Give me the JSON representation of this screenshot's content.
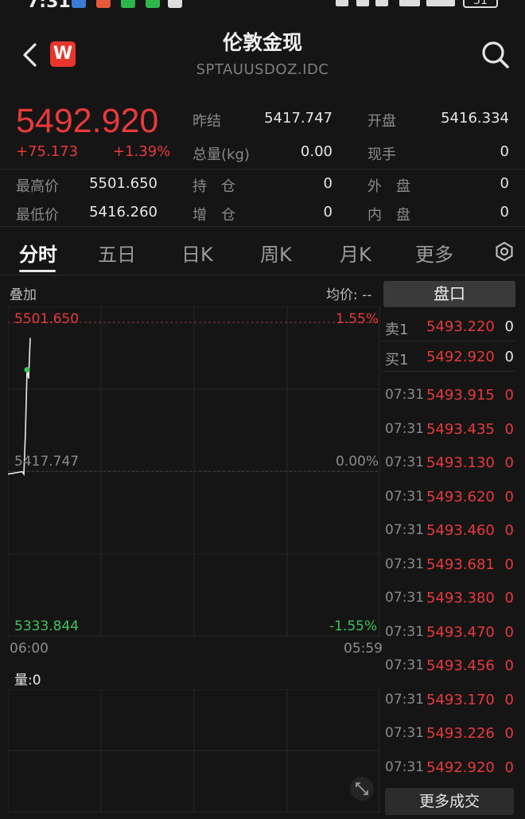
{
  "status_bar": {
    "time": "7:31",
    "battery": "51"
  },
  "header": {
    "title": "伦敦金现",
    "subtitle": "SPTAUUSDOZ.IDC",
    "logo_letter": "W"
  },
  "quote": {
    "price": "5492.920",
    "change": "+75.173",
    "change_pct": "+1.39%",
    "stats": [
      {
        "label": "昨结",
        "value": "5417.747"
      },
      {
        "label": "开盘",
        "value": "5416.334"
      },
      {
        "label": "总量(kg)",
        "value": "0.00"
      },
      {
        "label": "现手",
        "value": "0"
      },
      {
        "label": "最高价",
        "value": "5501.650"
      },
      {
        "label": "持　仓",
        "value": "0"
      },
      {
        "label": "外　盘",
        "value": "0"
      },
      {
        "label": "最低价",
        "value": "5416.260"
      },
      {
        "label": "增　仓",
        "value": "0"
      },
      {
        "label": "内　盘",
        "value": "0"
      }
    ]
  },
  "tabs": [
    "分时",
    "五日",
    "日K",
    "周K",
    "月K",
    "更多"
  ],
  "chart_labels": {
    "overlay": "叠加",
    "avg_price": "均价: --",
    "high": "5501.650",
    "high_pct": "1.55%",
    "mid": "5417.747",
    "mid_pct": "0.00%",
    "low": "5333.844",
    "low_pct": "-1.55%",
    "time_start": "06:00",
    "time_end": "05:59",
    "volume": "量:0"
  },
  "chart_data": {
    "type": "line",
    "x": [
      "06:00",
      "06:01",
      "06:02",
      "06:03",
      "06:04",
      "06:05",
      "06:06"
    ],
    "values": [
      5416.3,
      5417.7,
      5416.3,
      5440.0,
      5475.0,
      5470.0,
      5492.92
    ],
    "ylim": [
      5333.844,
      5501.65
    ],
    "reference": 5417.747,
    "grid": true
  },
  "order_book": {
    "header": "盘口",
    "ask": {
      "label": "卖1",
      "price": "5493.220",
      "qty": "0"
    },
    "bid": {
      "label": "买1",
      "price": "5492.920",
      "qty": "0"
    }
  },
  "trades": [
    {
      "time": "07:31",
      "price": "5493.915",
      "qty": "0"
    },
    {
      "time": "07:31",
      "price": "5493.435",
      "qty": "0"
    },
    {
      "time": "07:31",
      "price": "5493.130",
      "qty": "0"
    },
    {
      "time": "07:31",
      "price": "5493.620",
      "qty": "0"
    },
    {
      "time": "07:31",
      "price": "5493.460",
      "qty": "0"
    },
    {
      "time": "07:31",
      "price": "5493.681",
      "qty": "0"
    },
    {
      "time": "07:31",
      "price": "5493.380",
      "qty": "0"
    },
    {
      "time": "07:31",
      "price": "5493.470",
      "qty": "0"
    },
    {
      "time": "07:31",
      "price": "5493.456",
      "qty": "0"
    },
    {
      "time": "07:31",
      "price": "5493.170",
      "qty": "0"
    },
    {
      "time": "07:31",
      "price": "5493.226",
      "qty": "0"
    },
    {
      "time": "07:31",
      "price": "5492.920",
      "qty": "0"
    }
  ],
  "more_trades_label": "更多成交"
}
